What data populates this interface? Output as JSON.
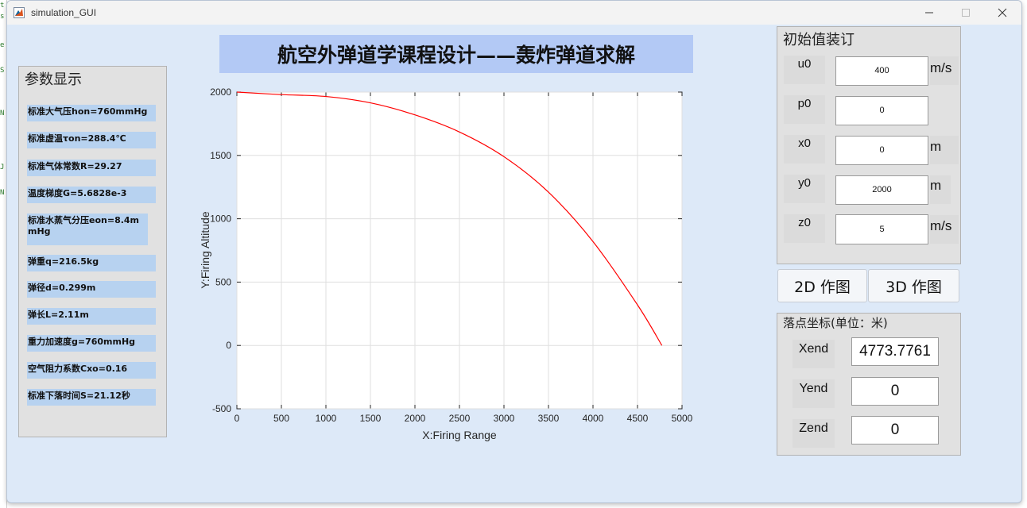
{
  "window": {
    "title": "simulation_GUI"
  },
  "header": {
    "title": "航空外弹道学课程设计——轰炸弹道求解"
  },
  "params_panel": {
    "title": "参数显示",
    "items": [
      "标准大气压hon=760mmHg",
      "标准虚温τon=288.4℃",
      "标准气体常数R=29.27",
      "温度梯度G=5.6828e-3",
      "标准水蒸气分压eon=8.4mmHg",
      "弹重q=216.5kg",
      "弹径d=0.299m",
      "弹长L=2.11m",
      "重力加速度g=760mmHg",
      "空气阻力系数Cxo=0.16",
      "标准下落时间S=21.12秒"
    ]
  },
  "init_panel": {
    "title": "初始值装订",
    "rows": [
      {
        "label": "u0",
        "value": "400",
        "unit": "m/s"
      },
      {
        "label": "p0",
        "value": "0",
        "unit": ""
      },
      {
        "label": "x0",
        "value": "0",
        "unit": "m"
      },
      {
        "label": "y0",
        "value": "2000",
        "unit": "m"
      },
      {
        "label": "z0",
        "value": "5",
        "unit": "m/s"
      }
    ]
  },
  "buttons": {
    "plot2d": "2D 作图",
    "plot3d": "3D 作图"
  },
  "impact_panel": {
    "title": "落点坐标(单位：米)",
    "rows": [
      {
        "label": "Xend",
        "value": "4773.7761"
      },
      {
        "label": "Yend",
        "value": "0"
      },
      {
        "label": "Zend",
        "value": "0"
      }
    ]
  },
  "chart_data": {
    "type": "line",
    "xlabel": "X:Firing Range",
    "ylabel": "Y:Firing Altitude",
    "xlim": [
      0,
      5000
    ],
    "ylim": [
      -500,
      2000
    ],
    "xticks": [
      0,
      500,
      1000,
      1500,
      2000,
      2500,
      3000,
      3500,
      4000,
      4500,
      5000
    ],
    "yticks": [
      -500,
      0,
      500,
      1000,
      1500,
      2000
    ],
    "grid": true,
    "series": [
      {
        "color": "#ff0000",
        "x": [
          0,
          500,
          1000,
          1500,
          2000,
          2500,
          3000,
          3500,
          4000,
          4500,
          4773.8
        ],
        "y": [
          2000,
          1980,
          1965,
          1915,
          1820,
          1685,
          1490,
          1210,
          820,
          320,
          0
        ]
      }
    ]
  }
}
